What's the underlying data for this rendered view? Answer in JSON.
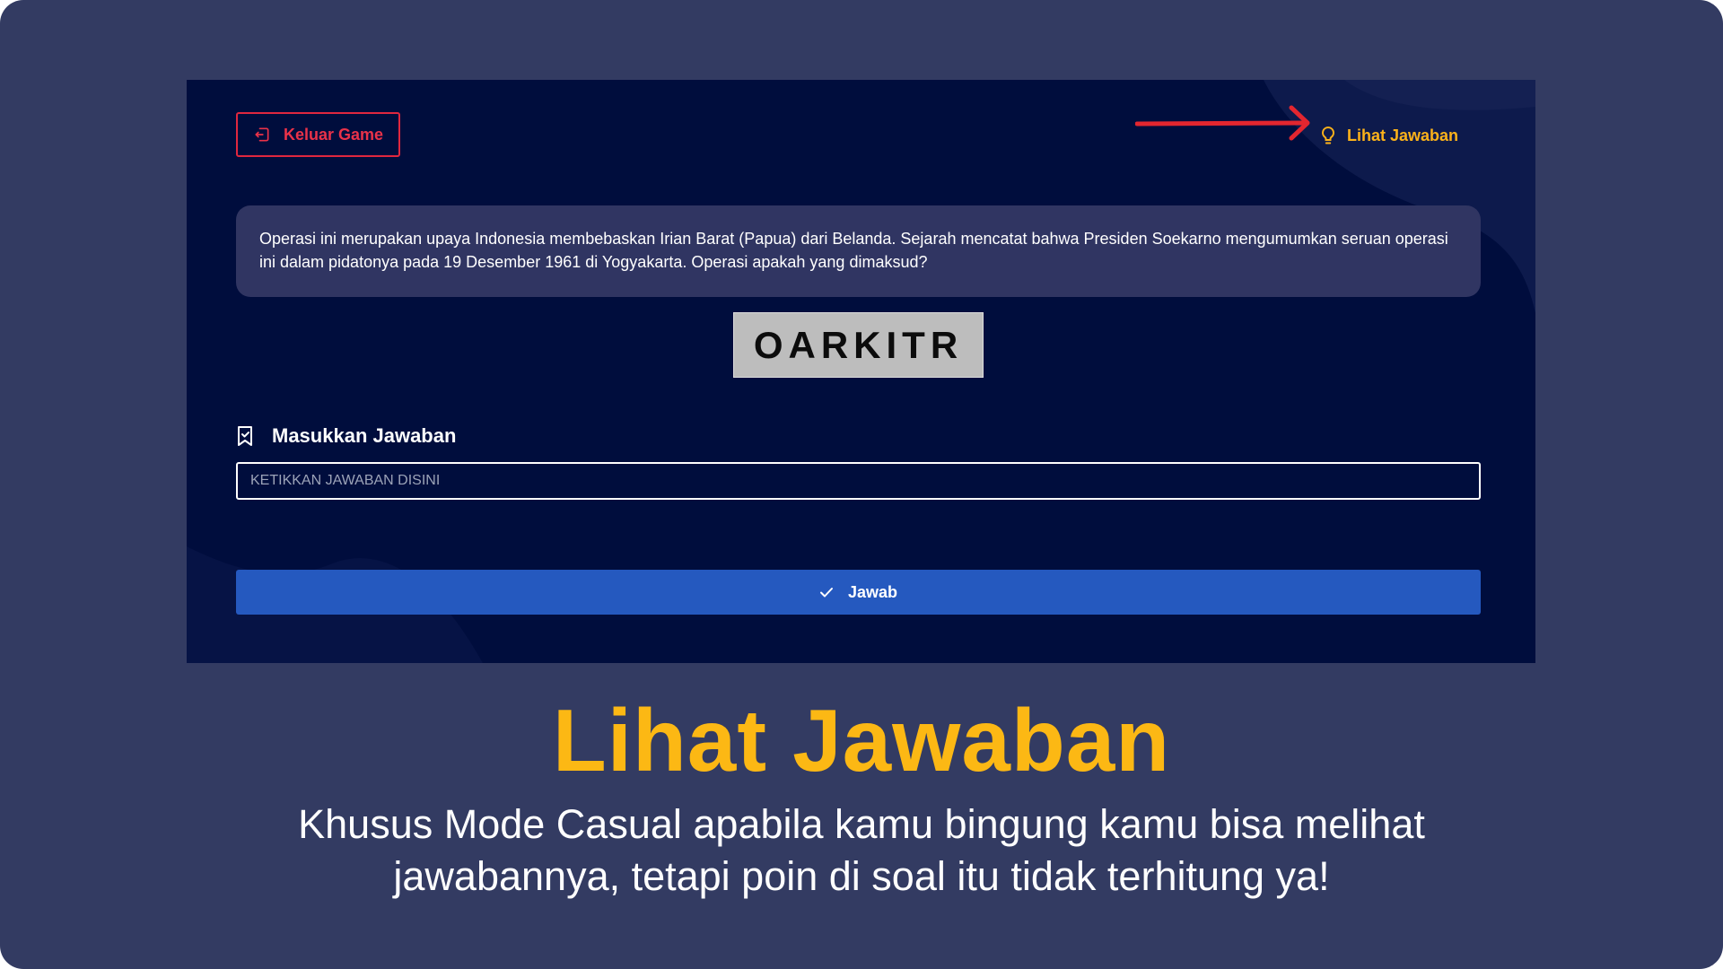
{
  "game": {
    "exit_label": "Keluar Game",
    "hint_label": "Lihat Jawaban",
    "question": "Operasi ini merupakan upaya Indonesia membebaskan Irian Barat (Papua) dari Belanda. Sejarah mencatat bahwa Presiden Soekarno mengumumkan seruan operasi ini dalam pidatonya pada 19 Desember 1961 di Yogyakarta. Operasi apakah yang dimaksud?",
    "scrambled_word": "OARKITR",
    "answer_label": "Masukkan Jawaban",
    "answer_placeholder": "KETIKKAN JAWABAN DISINI",
    "answer_value": "",
    "submit_label": "Jawab"
  },
  "caption": {
    "title": "Lihat Jawaban",
    "body": "Khusus Mode Casual apabila kamu bingung kamu bisa melihat jawabannya, tetapi poin di soal itu tidak terhitung ya!"
  },
  "icons": {
    "exit": "exit-icon",
    "hint": "lightbulb-icon",
    "label": "bookmark-icon",
    "submit": "check-icon",
    "annotation": "red-arrow-icon"
  },
  "colors": {
    "frame_bg": "#333b62",
    "game_bg": "#000d3d",
    "question_bg": "#303562",
    "exit_red": "#ea3249",
    "hint_yellow": "#fbb21a",
    "submit_blue": "#2559bf",
    "caption_yellow": "#fcb814",
    "scramble_bg": "#bdbdbd"
  }
}
